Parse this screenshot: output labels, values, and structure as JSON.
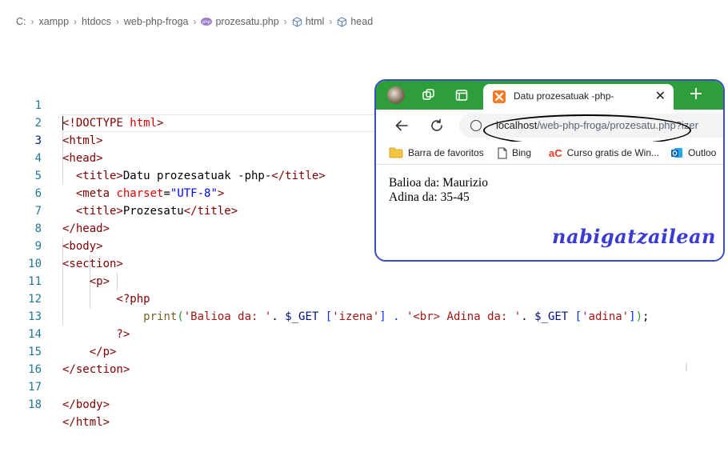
{
  "breadcrumb": {
    "items": [
      "C:",
      "xampp",
      "htdocs",
      "web-php-froga",
      "prozesatu.php",
      "html",
      "head"
    ],
    "separator": ">"
  },
  "editor": {
    "lines": [
      {
        "number": "1"
      },
      {
        "number": "2"
      },
      {
        "number": "3"
      },
      {
        "number": "4"
      },
      {
        "number": "5"
      },
      {
        "number": "6"
      },
      {
        "number": "7"
      },
      {
        "number": "8"
      },
      {
        "number": "9"
      },
      {
        "number": "10"
      },
      {
        "number": "11"
      },
      {
        "number": "12"
      },
      {
        "number": "13"
      },
      {
        "number": "14"
      },
      {
        "number": "15"
      },
      {
        "number": "16"
      },
      {
        "number": "17"
      },
      {
        "number": "18"
      }
    ],
    "current_line": 3,
    "tokens": {
      "l1a": "<!DOCTYPE ",
      "l1b": "html",
      "l1c": ">",
      "l2": "<html>",
      "l3": "<head>",
      "l4a": "  <title>",
      "l4b": "Datu prozesatuak -php-",
      "l4c": "</title>",
      "l5a": "  <meta ",
      "l5b": "charset",
      "l5c": "=",
      "l5d": "\"UTF-8\"",
      "l5e": ">",
      "l6a": "  <title>",
      "l6b": "Prozesatu",
      "l6c": "</title>",
      "l7": "</head>",
      "l8": "<body>",
      "l9": "<section>",
      "l10": "    <p>",
      "l11": "        <?php",
      "l12a": "            ",
      "l12b": "print",
      "l12c": "(",
      "l12d": "'Balioa da: '",
      "l12e": ". ",
      "l12f": "$_GET",
      "l12g": " [",
      "l12h": "'izena'",
      "l12i": "] . ",
      "l12j": "'<br> Adina da: '",
      "l12k": ". ",
      "l12l": "$_GET",
      "l12m": " [",
      "l12n": "'adina'",
      "l12o": "]",
      "l12p": ")",
      "l12q": ";",
      "l13": "        ?>",
      "l14": "    </p>",
      "l15": "</section>",
      "l17": "</body>",
      "l18": "</html>"
    }
  },
  "browser": {
    "tab_title": "Datu prozesatuak -php-",
    "tab_close": "✕",
    "new_tab": "+",
    "url_host": "localhost",
    "url_path": "/web-php-froga/prozesatu.php?izer",
    "favorites": [
      "Barra de favoritos",
      "Bing",
      "Curso gratis de Win...",
      "Outloo"
    ],
    "favorite_badge": "aC",
    "page_lines": [
      "Balioa da: Maurizio",
      "Adina da: 35-45"
    ],
    "signature": "nabigatzailean",
    "colors": {
      "tabbar": "#2e9e3a",
      "border": "#3b4cc0",
      "signature": "#3b3bd4"
    }
  }
}
